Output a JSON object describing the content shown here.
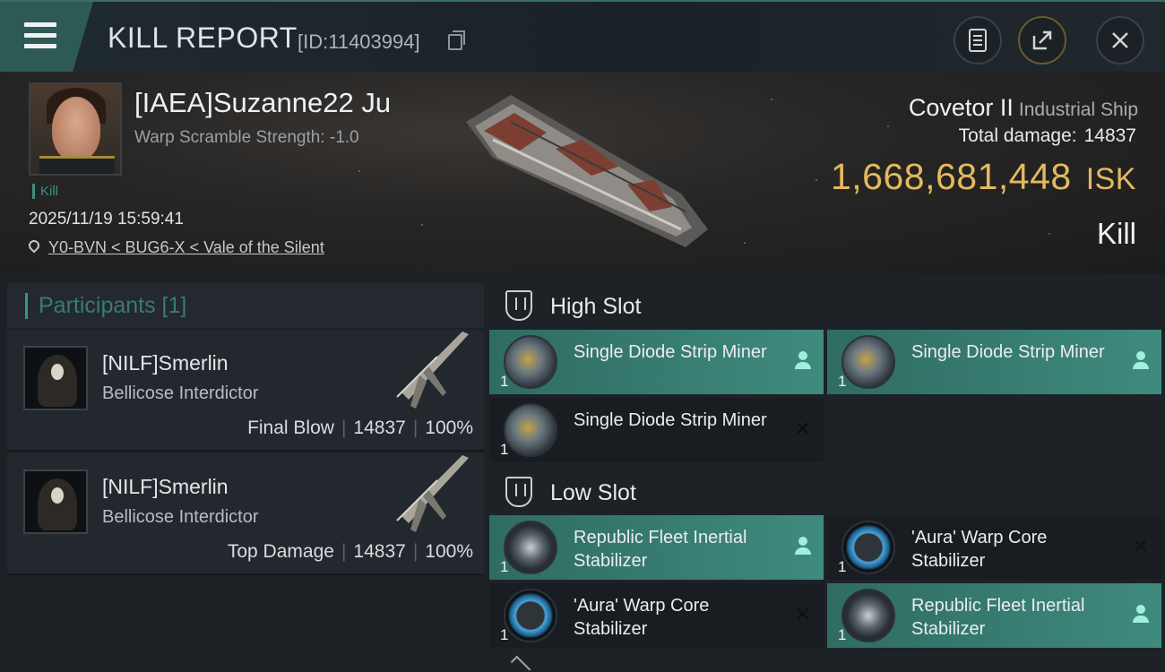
{
  "header": {
    "title": "KILL REPORT",
    "report_id": "[ID:11403994]"
  },
  "victim": {
    "name": "[IAEA]Suzanne22 Ju",
    "warp_scramble": "Warp Scramble Strength: -1.0",
    "kill_tag": "Kill",
    "timestamp": "2025/11/19 15:59:41",
    "location": "Y0-BVN < BUG6-X < Vale of the Silent",
    "ship_name": "Covetor II",
    "ship_class": "Industrial Ship",
    "total_damage_label": "Total damage:",
    "total_damage": "14837",
    "isk_value": "1,668,681,448",
    "isk_unit": "ISK",
    "status": "Kill"
  },
  "participants": {
    "header": "Participants [1]",
    "rows": [
      {
        "name": "[NILF]Smerlin",
        "ship": "Bellicose Interdictor",
        "label": "Final Blow",
        "damage": "14837",
        "percent": "100%"
      },
      {
        "name": "[NILF]Smerlin",
        "ship": "Bellicose Interdictor",
        "label": "Top Damage",
        "damage": "14837",
        "percent": "100%"
      }
    ]
  },
  "fitting": {
    "high_slot_label": "High Slot",
    "low_slot_label": "Low Slot",
    "high_modules": [
      {
        "name": "Single Diode Strip Miner",
        "qty": "1",
        "state": "dropped"
      },
      {
        "name": "Single Diode Strip Miner",
        "qty": "1",
        "state": "dropped"
      },
      {
        "name": "Single Diode Strip Miner",
        "qty": "1",
        "state": "destroyed"
      }
    ],
    "low_modules": [
      {
        "name": "Republic Fleet Inertial Stabilizer",
        "qty": "1",
        "state": "dropped"
      },
      {
        "name": "'Aura' Warp Core Stabilizer",
        "qty": "1",
        "state": "destroyed"
      },
      {
        "name": "'Aura' Warp Core Stabilizer",
        "qty": "1",
        "state": "destroyed"
      },
      {
        "name": "Republic Fleet Inertial Stabilizer",
        "qty": "1",
        "state": "dropped"
      }
    ],
    "destroyed_mark": "✕"
  },
  "colors": {
    "accent_teal": "#3f8a7e",
    "isk_gold": "#e4b95f"
  },
  "icons": {
    "menu": "menu-icon",
    "copy": "copy-icon",
    "doc": "document-icon",
    "share": "share-icon",
    "close": "close-icon"
  }
}
